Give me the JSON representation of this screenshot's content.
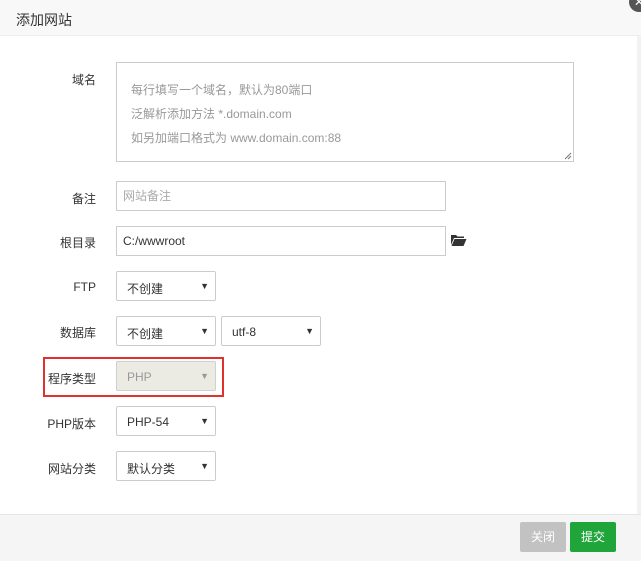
{
  "dialog": {
    "title": "添加网站",
    "close_icon": "x-icon"
  },
  "form": {
    "domain": {
      "label": "域名",
      "placeholder_lines": [
        "每行填写一个域名，默认为80端口",
        "泛解析添加方法 *.domain.com",
        "如另加端口格式为 www.domain.com:88"
      ]
    },
    "remark": {
      "label": "备注",
      "placeholder": "网站备注",
      "value": ""
    },
    "root": {
      "label": "根目录",
      "value": "C:/wwwroot",
      "icon": "folder-open-icon"
    },
    "ftp": {
      "label": "FTP",
      "selected": "不创建"
    },
    "database": {
      "label": "数据库",
      "selected": "不创建",
      "charset": "utf-8"
    },
    "program_type": {
      "label": "程序类型",
      "selected": "PHP",
      "disabled": true,
      "highlight_color": "#e0312f"
    },
    "php_version": {
      "label": "PHP版本",
      "selected": "PHP-54"
    },
    "category": {
      "label": "网站分类",
      "selected": "默认分类"
    }
  },
  "footer": {
    "close_label": "关闭",
    "submit_label": "提交",
    "submit_color": "#20a53a",
    "close_color": "#c2c2c2"
  }
}
